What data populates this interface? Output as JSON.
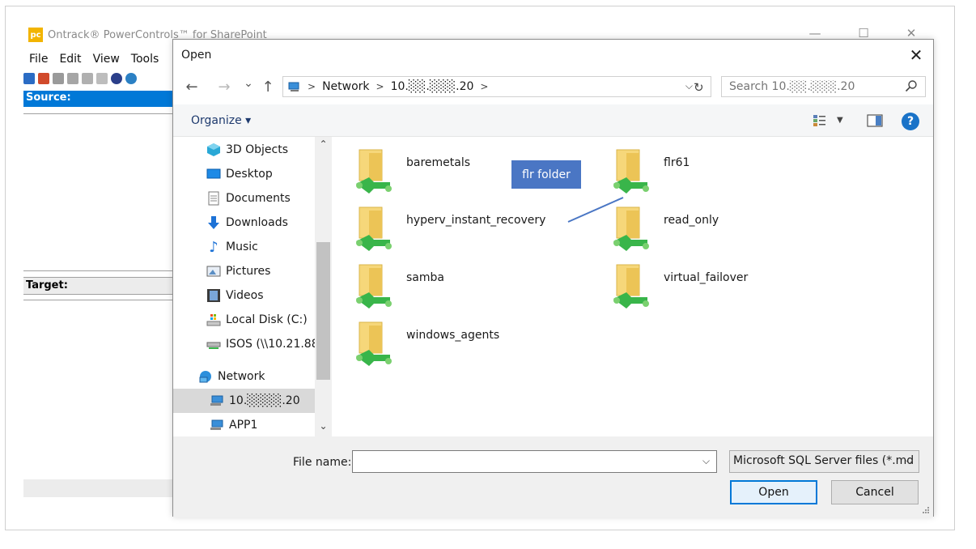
{
  "app": {
    "logo_text": "pc",
    "title": "Ontrack® PowerControls™ for SharePoint",
    "menu": [
      "File",
      "Edit",
      "View",
      "Tools"
    ],
    "source_label": "Source:",
    "target_label": "Target:",
    "window_controls": [
      "—",
      "☐",
      "✕"
    ]
  },
  "dialog": {
    "title": "Open",
    "close": "✕",
    "nav": {
      "back": "←",
      "forward": "→",
      "recent": "⌄",
      "up": "↑",
      "breadcrumb": [
        "Network",
        "10.░░.░░░.20"
      ],
      "refresh": "↻",
      "search_placeholder": "Search 10.░░.░░░.20",
      "search_icon": "magnifier-icon"
    },
    "command_bar": {
      "organize": "Organize ▾",
      "help": "?"
    },
    "nav_pane": {
      "items": [
        {
          "label": "3D Objects",
          "icon": "3d-objects-icon"
        },
        {
          "label": "Desktop",
          "icon": "desktop-icon"
        },
        {
          "label": "Documents",
          "icon": "documents-icon"
        },
        {
          "label": "Downloads",
          "icon": "downloads-icon"
        },
        {
          "label": "Music",
          "icon": "music-icon"
        },
        {
          "label": "Pictures",
          "icon": "pictures-icon"
        },
        {
          "label": "Videos",
          "icon": "videos-icon"
        },
        {
          "label": "Local Disk (C:)",
          "icon": "local-disk-icon"
        },
        {
          "label": "ISOS (\\\\10.21.88.",
          "icon": "network-drive-icon"
        },
        {
          "label": "Network",
          "icon": "network-icon"
        },
        {
          "label": "10.░░░░.20",
          "icon": "computer-icon",
          "selected": true
        },
        {
          "label": "APP1",
          "icon": "computer-icon"
        }
      ]
    },
    "folders": [
      {
        "name": "baremetals"
      },
      {
        "name": "flr61"
      },
      {
        "name": "hyperv_instant_recovery"
      },
      {
        "name": "read_only"
      },
      {
        "name": "samba"
      },
      {
        "name": "virtual_failover"
      },
      {
        "name": "windows_agents"
      }
    ],
    "callout": "flr folder",
    "file_name_label": "File name:",
    "file_name_value": "",
    "file_type": "Microsoft SQL Server files (*.md",
    "open_button": "Open",
    "cancel_button": "Cancel"
  },
  "colors": {
    "accent": "#0078d7",
    "callout": "#4a76c4",
    "folder": "#f6d77a",
    "share_badge": "#39b54a"
  }
}
